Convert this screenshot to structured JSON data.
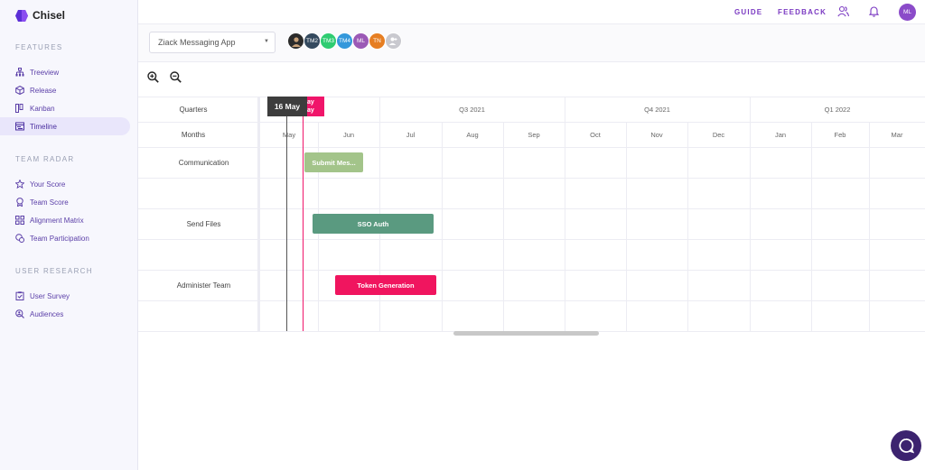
{
  "app": {
    "name": "Chisel"
  },
  "sidebar": {
    "sections": [
      {
        "title": "FEATURES",
        "items": [
          {
            "label": "Treeview",
            "icon": "treeview-icon"
          },
          {
            "label": "Release",
            "icon": "release-cube-icon"
          },
          {
            "label": "Kanban",
            "icon": "kanban-icon"
          },
          {
            "label": "Timeline",
            "icon": "timeline-icon",
            "active": true
          }
        ]
      },
      {
        "title": "TEAM RADAR",
        "items": [
          {
            "label": "Your Score",
            "icon": "star-icon"
          },
          {
            "label": "Team Score",
            "icon": "award-icon"
          },
          {
            "label": "Alignment Matrix",
            "icon": "grid-icon"
          },
          {
            "label": "Team Participation",
            "icon": "participation-icon"
          }
        ]
      },
      {
        "title": "USER RESEARCH",
        "items": [
          {
            "label": "User Survey",
            "icon": "clipboard-check-icon"
          },
          {
            "label": "Audiences",
            "icon": "search-user-icon"
          }
        ]
      }
    ]
  },
  "topbar": {
    "guide_label": "GUIDE",
    "feedback_label": "FEEDBACK",
    "user_initials": "ML"
  },
  "toolbar": {
    "project": "Ziack Messaging App",
    "members": [
      {
        "initials": "",
        "color": "#2b2b2b",
        "photo": true
      },
      {
        "initials": "TM2",
        "color": "#34495e"
      },
      {
        "initials": "TM3",
        "color": "#2ecc71"
      },
      {
        "initials": "TM4",
        "color": "#3498db"
      },
      {
        "initials": "ML",
        "color": "#9b59b6"
      },
      {
        "initials": "TN",
        "color": "#e67e22"
      }
    ]
  },
  "timeline": {
    "header_quarters_label": "Quarters",
    "header_months_label": "Months",
    "quarters": [
      "Q3 2021",
      "Q4 2021",
      "Q1 2022"
    ],
    "months": [
      "May",
      "Jun",
      "Jul",
      "Aug",
      "Sep",
      "Oct",
      "Nov",
      "Dec",
      "Jan",
      "Feb",
      "Mar"
    ],
    "today_label": "16 May",
    "marker_label": "ay ay",
    "rows": [
      {
        "label": "Communication",
        "bar": {
          "text": "Submit Mes...",
          "color": "#a3c48a",
          "start": "Jun 1",
          "end": "Jun 30"
        }
      },
      {
        "label": "",
        "bar": null
      },
      {
        "label": "Send Files",
        "bar": {
          "text": "SSO Auth",
          "color": "#5a9a80",
          "start": "Jun 5",
          "end": "Aug 10"
        }
      },
      {
        "label": "",
        "bar": null
      },
      {
        "label": "Administer Team",
        "bar": {
          "text": "Token Generation",
          "color": "#f0155f",
          "start": "Jun 16",
          "end": "Aug 12"
        }
      },
      {
        "label": "",
        "bar": null
      }
    ]
  },
  "colors": {
    "accent": "#7b3ac2",
    "active_bg": "#e9e6fb",
    "today": "#3d3d3d",
    "marker": "#f0156a"
  }
}
